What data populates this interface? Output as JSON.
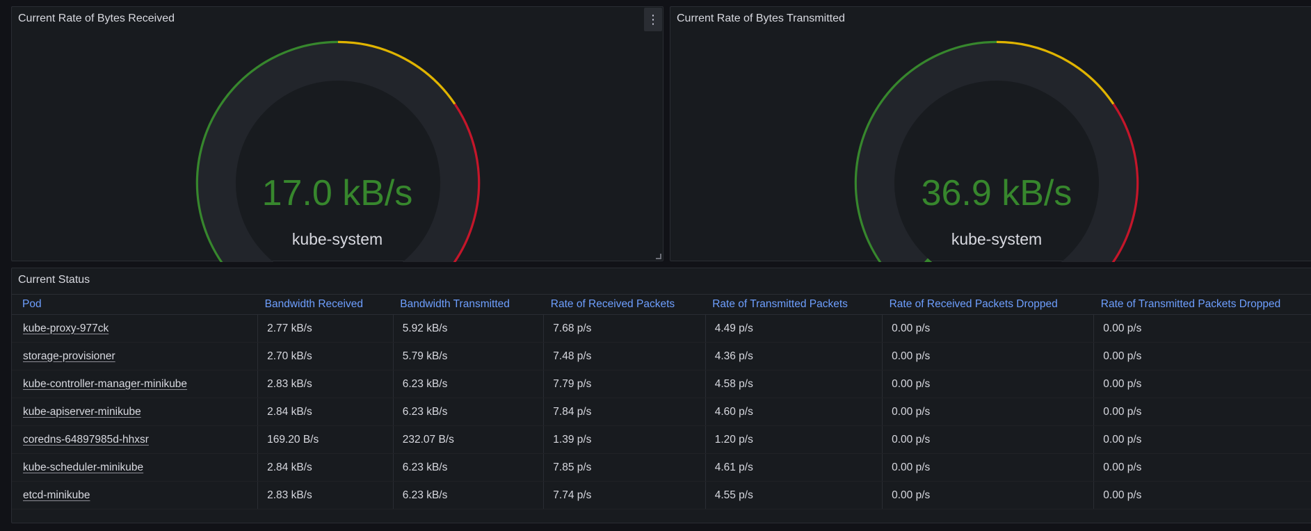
{
  "gauges": [
    {
      "title": "Current Rate of Bytes Received",
      "value": "17.0 kB/s",
      "label": "kube-system",
      "fill_fraction": 0.03,
      "colors": {
        "value": "#37872d",
        "green": "#37872d",
        "yellow": "#e0b400",
        "red": "#c4162a",
        "track": "#22252b"
      }
    },
    {
      "title": "Current Rate of Bytes Transmitted",
      "value": "36.9 kB/s",
      "label": "kube-system",
      "fill_fraction": 0.07,
      "colors": {
        "value": "#37872d",
        "green": "#37872d",
        "yellow": "#e0b400",
        "red": "#c4162a",
        "track": "#22252b"
      }
    }
  ],
  "panel_menu_icon": "kebab-menu-icon",
  "status": {
    "title": "Current Status",
    "columns": [
      "Pod",
      "Bandwidth Received",
      "Bandwidth Transmitted",
      "Rate of Received Packets",
      "Rate of Transmitted Packets",
      "Rate of Received Packets Dropped",
      "Rate of Transmitted Packets Dropped"
    ],
    "rows": [
      [
        "kube-proxy-977ck",
        "2.77 kB/s",
        "5.92 kB/s",
        "7.68 p/s",
        "4.49 p/s",
        "0.00 p/s",
        "0.00 p/s"
      ],
      [
        "storage-provisioner",
        "2.70 kB/s",
        "5.79 kB/s",
        "7.48 p/s",
        "4.36 p/s",
        "0.00 p/s",
        "0.00 p/s"
      ],
      [
        "kube-controller-manager-minikube",
        "2.83 kB/s",
        "6.23 kB/s",
        "7.79 p/s",
        "4.58 p/s",
        "0.00 p/s",
        "0.00 p/s"
      ],
      [
        "kube-apiserver-minikube",
        "2.84 kB/s",
        "6.23 kB/s",
        "7.84 p/s",
        "4.60 p/s",
        "0.00 p/s",
        "0.00 p/s"
      ],
      [
        "coredns-64897985d-hhxsr",
        "169.20 B/s",
        "232.07 B/s",
        "1.39 p/s",
        "1.20 p/s",
        "0.00 p/s",
        "0.00 p/s"
      ],
      [
        "kube-scheduler-minikube",
        "2.84 kB/s",
        "6.23 kB/s",
        "7.85 p/s",
        "4.61 p/s",
        "0.00 p/s",
        "0.00 p/s"
      ],
      [
        "etcd-minikube",
        "2.83 kB/s",
        "6.23 kB/s",
        "7.74 p/s",
        "4.55 p/s",
        "0.00 p/s",
        "0.00 p/s"
      ]
    ],
    "header_color": "#6e9fff"
  }
}
